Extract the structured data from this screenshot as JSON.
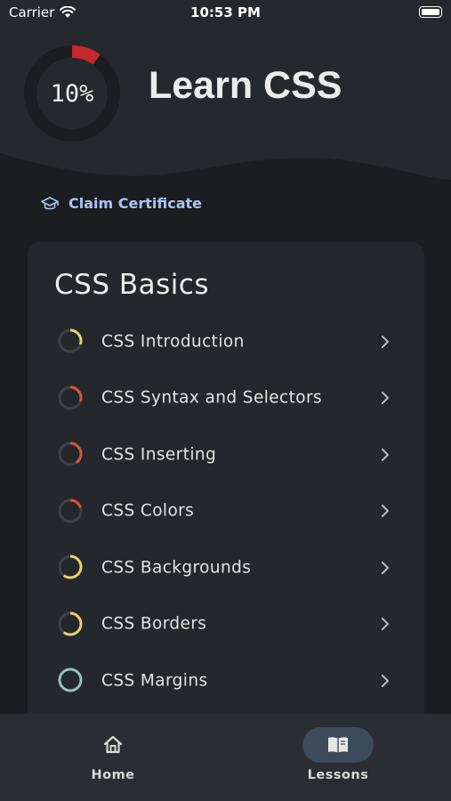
{
  "status_bar": {
    "carrier": "Carrier",
    "time": "10:53 PM"
  },
  "header": {
    "progress_percent": 10,
    "progress_label": "10%",
    "title": "Learn CSS",
    "progress_color": "#c8282c",
    "track_color": "#1b1d20"
  },
  "claim_certificate": {
    "label": "Claim Certificate",
    "icon": "graduation-cap-icon",
    "color": "#aac4f2"
  },
  "section": {
    "title": "CSS Basics",
    "lessons": [
      {
        "label": "CSS Introduction",
        "progress": 0.3,
        "color": "#e8d26a"
      },
      {
        "label": "CSS Syntax and Selectors",
        "progress": 0.3,
        "color": "#d8553a"
      },
      {
        "label": "CSS Inserting",
        "progress": 0.4,
        "color": "#d8553a"
      },
      {
        "label": "CSS Colors",
        "progress": 0.2,
        "color": "#d8553a"
      },
      {
        "label": "CSS Backgrounds",
        "progress": 0.6,
        "color": "#e8d26a"
      },
      {
        "label": "CSS Borders",
        "progress": 0.6,
        "color": "#e8d26a"
      },
      {
        "label": "CSS Margins",
        "progress": 1.0,
        "color": "#8fc3b4"
      }
    ]
  },
  "tabbar": {
    "home_label": "Home",
    "lessons_label": "Lessons",
    "active": "Lessons"
  }
}
